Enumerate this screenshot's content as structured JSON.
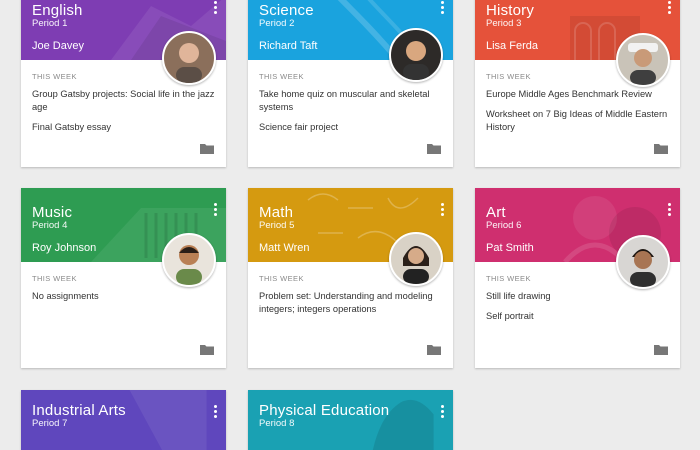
{
  "week_label": "THIS WEEK",
  "colors": {
    "english": "#7e3db3",
    "science": "#1aa3de",
    "history": "#e5523a",
    "music": "#2e9c52",
    "math": "#d59a10",
    "art": "#cf2f6f",
    "industrial": "#5f47bd",
    "physical": "#1aa1b3"
  },
  "classes": [
    {
      "title": "English",
      "period": "Period 1",
      "teacher": "Joe Davey",
      "items": [
        "Group Gatsby projects: Social life in the jazz age",
        "Final Gatsby essay"
      ]
    },
    {
      "title": "Science",
      "period": "Period 2",
      "teacher": "Richard Taft",
      "items": [
        "Take home quiz on muscular and skeletal systems",
        "Science fair project"
      ]
    },
    {
      "title": "History",
      "period": "Period 3",
      "teacher": "Lisa Ferda",
      "items": [
        "Europe Middle Ages Benchmark Review",
        "Worksheet on 7 Big Ideas of Middle Eastern History"
      ]
    },
    {
      "title": "Music",
      "period": "Period 4",
      "teacher": "Roy Johnson",
      "items": [
        "No assignments"
      ]
    },
    {
      "title": "Math",
      "period": "Period 5",
      "teacher": "Matt Wren",
      "items": [
        "Problem set: Understanding and modeling integers; integers operations"
      ]
    },
    {
      "title": "Art",
      "period": "Period 6",
      "teacher": "Pat Smith",
      "items": [
        "Still life drawing",
        "Self portrait"
      ]
    },
    {
      "title": "Industrial Arts",
      "period": "Period 7"
    },
    {
      "title": "Physical Education",
      "period": "Period 8"
    }
  ],
  "icons": {
    "menu": "more-vert-icon",
    "folder": "folder-icon",
    "avatar": "teacher-avatar"
  }
}
